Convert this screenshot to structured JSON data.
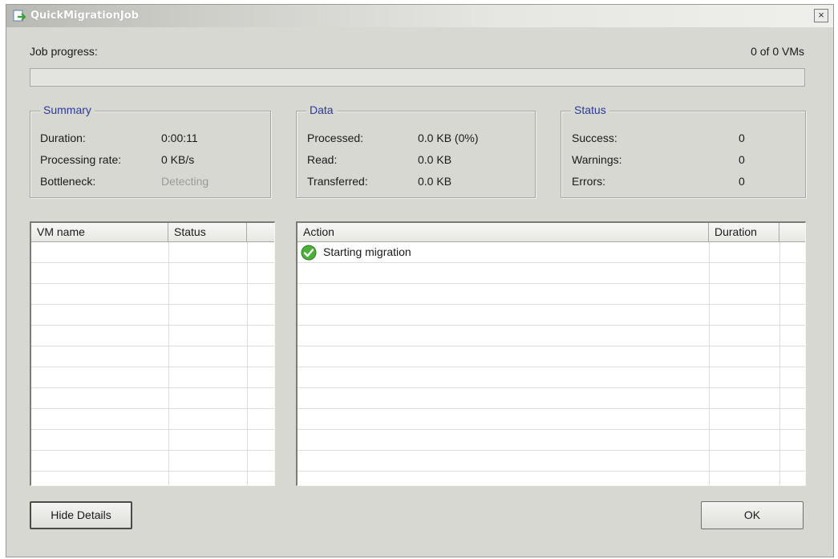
{
  "window": {
    "title": "QuickMigrationJob",
    "close_glyph": "×"
  },
  "progress": {
    "label": "Job progress:",
    "count_text": "0 of 0 VMs",
    "fraction": 0
  },
  "summary": {
    "legend": "Summary",
    "duration_label": "Duration:",
    "duration_value": "0:00:11",
    "rate_label": "Processing rate:",
    "rate_value": "0 KB/s",
    "bottleneck_label": "Bottleneck:",
    "bottleneck_value": "Detecting"
  },
  "data": {
    "legend": "Data",
    "processed_label": "Processed:",
    "processed_value": "0.0 KB (0%)",
    "read_label": "Read:",
    "read_value": "0.0 KB",
    "transferred_label": "Transferred:",
    "transferred_value": "0.0 KB"
  },
  "status": {
    "legend": "Status",
    "success_label": "Success:",
    "success_value": "0",
    "warnings_label": "Warnings:",
    "warnings_value": "0",
    "errors_label": "Errors:",
    "errors_value": "0"
  },
  "vm_list": {
    "columns": [
      "VM name",
      "Status"
    ],
    "rows": []
  },
  "action_list": {
    "columns": [
      "Action",
      "Duration"
    ],
    "rows": [
      {
        "action": "Starting migration",
        "duration": "",
        "icon": "success-check-icon"
      }
    ]
  },
  "buttons": {
    "hide_details": "Hide Details",
    "ok": "OK"
  },
  "colors": {
    "legend_text": "#2b3a9a",
    "success_icon": "#4caf3a",
    "window_bg": "#d8d8d3"
  }
}
